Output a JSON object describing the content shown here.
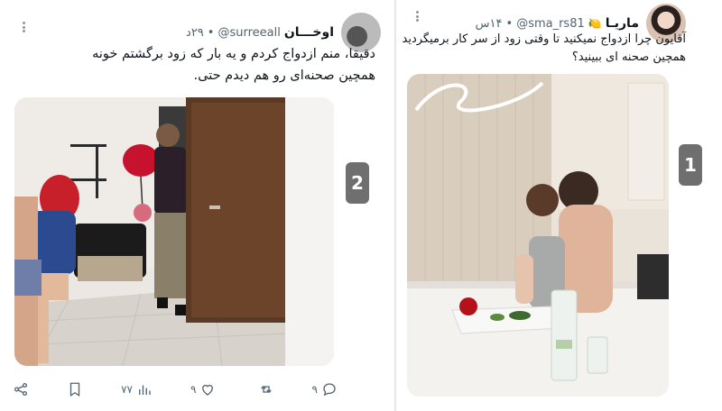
{
  "left_post": {
    "display_name": "اوخـــان",
    "handle": "@surreeall",
    "time": "۲۹د",
    "text_line1": "دقیقا، منم ازدواج کردم و یه بار که زود برگشتم خونه",
    "text_line2": "همچین صحنه‌ای رو هم دیدم حتی.",
    "badge": "2",
    "actions": {
      "reply_count": "۹",
      "retweet_count": "",
      "like_count": "۹",
      "views_count": "۷۷"
    }
  },
  "right_post": {
    "display_name": "ماریـا",
    "handle": "@sma_rs81",
    "time": "۱۴س",
    "emoji": "🍋",
    "text_line1": "آقایون چرا ازدواج نمیکنید تا وقتی زود از سر کار برمیگردید",
    "text_line2": "همچین صحنه ای ببینید؟",
    "badge": "1"
  },
  "colors": {
    "text_primary": "#0f1419",
    "text_secondary": "#536471",
    "badge_bg": "#6f6f6f"
  }
}
